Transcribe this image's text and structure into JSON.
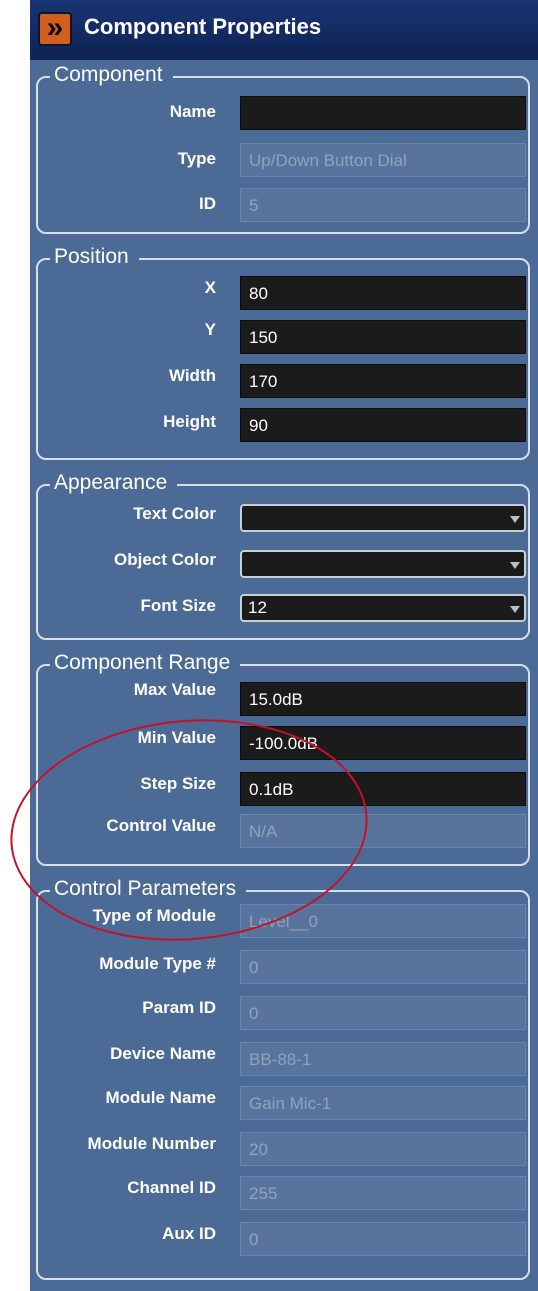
{
  "header": {
    "title": "Component Properties",
    "collapse_icon": "double-chevron-right-icon"
  },
  "component": {
    "legend": "Component",
    "name_label": "Name",
    "name_value": "",
    "type_label": "Type",
    "type_value": "Up/Down Button Dial",
    "id_label": "ID",
    "id_value": "5"
  },
  "position": {
    "legend": "Position",
    "x_label": "X",
    "x_value": "80",
    "y_label": "Y",
    "y_value": "150",
    "width_label": "Width",
    "width_value": "170",
    "height_label": "Height",
    "height_value": "90"
  },
  "appearance": {
    "legend": "Appearance",
    "text_color_label": "Text Color",
    "text_color_value": "",
    "object_color_label": "Object Color",
    "object_color_value": "",
    "font_size_label": "Font Size",
    "font_size_value": "12"
  },
  "range": {
    "legend": "Component Range",
    "max_label": "Max Value",
    "max_value": "15.0dB",
    "min_label": "Min Value",
    "min_value": "-100.0dB",
    "step_label": "Step Size",
    "step_value": "0.1dB",
    "control_label": "Control Value",
    "control_value": "N/A"
  },
  "control_params": {
    "legend": "Control Parameters",
    "type_module_label": "Type of Module",
    "type_module_value": "Level__0",
    "module_type_num_label": "Module Type #",
    "module_type_num_value": "0",
    "param_id_label": "Param ID",
    "param_id_value": "0",
    "device_name_label": "Device Name",
    "device_name_value": "BB-88-1",
    "module_name_label": "Module Name",
    "module_name_value": "Gain Mic-1",
    "module_number_label": "Module Number",
    "module_number_value": "20",
    "channel_id_label": "Channel ID",
    "channel_id_value": "255",
    "aux_id_label": "Aux ID",
    "aux_id_value": "0"
  },
  "colors": {
    "panel_bg": "#4c6a96",
    "header_bg": "#0e2354",
    "accent": "#d25f1e",
    "edit_field": "#1b1b1b",
    "annotation": "#c4122a"
  }
}
